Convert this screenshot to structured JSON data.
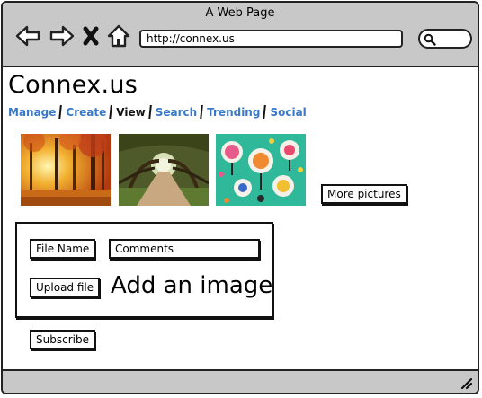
{
  "window": {
    "title": "A Web Page"
  },
  "browser": {
    "url": "http://connex.us",
    "back_icon": "back-arrow-icon",
    "forward_icon": "forward-arrow-icon",
    "stop_icon": "close-icon",
    "home_icon": "home-icon",
    "search_icon": "search-icon"
  },
  "site": {
    "title": "Connex.us"
  },
  "nav": {
    "tabs": [
      {
        "label": "Manage",
        "active": false
      },
      {
        "label": "Create",
        "active": false
      },
      {
        "label": "View",
        "active": true
      },
      {
        "label": "Search",
        "active": false
      },
      {
        "label": "Trending",
        "active": false
      },
      {
        "label": "Social",
        "active": false
      }
    ],
    "link_color": "#3a78c8"
  },
  "gallery": {
    "images": [
      "autumn-forest-image",
      "tree-tunnel-road-image",
      "illustrated-trees-pattern-image"
    ],
    "more_label": "More pictures"
  },
  "upload": {
    "file_name_label": "File Name",
    "comments_value": "Comments",
    "upload_label": "Upload file",
    "heading": "Add an image"
  },
  "subscribe_label": "Subscribe"
}
